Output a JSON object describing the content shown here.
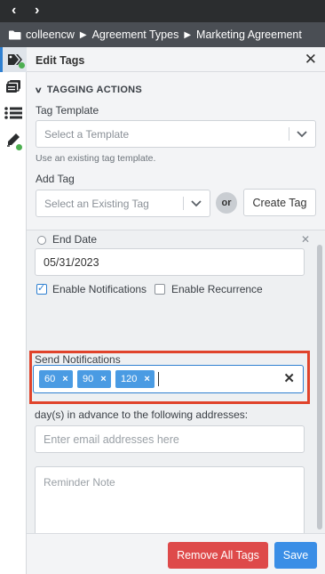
{
  "nav": {
    "back_icon": "chevron-left-icon",
    "forward_icon": "chevron-right-icon"
  },
  "breadcrumb": {
    "icon": "folder-icon",
    "items": [
      "colleencw",
      "Agreement Types",
      "Marketing Agreement"
    ]
  },
  "rail": {
    "items": [
      {
        "icon": "tag-icon",
        "active": true,
        "status_dot": true
      },
      {
        "icon": "stacked-documents-icon",
        "active": false,
        "status_dot": false
      },
      {
        "icon": "list-icon",
        "active": false,
        "status_dot": false
      },
      {
        "icon": "pen-icon",
        "active": false,
        "status_dot": true
      }
    ]
  },
  "panel": {
    "title": "Edit Tags",
    "section_title": "TAGGING ACTIONS",
    "tag_template": {
      "label": "Tag Template",
      "placeholder": "Select a Template",
      "hint": "Use an existing tag template."
    },
    "add_tag": {
      "label": "Add Tag",
      "placeholder": "Select an Existing Tag",
      "or_label": "or",
      "create_label": "Create Tag"
    },
    "end_date": {
      "label": "End Date",
      "value": "05/31/2023"
    },
    "enable_notifications": {
      "label": "Enable Notifications",
      "checked": true
    },
    "enable_recurrence": {
      "label": "Enable Recurrence",
      "checked": false
    },
    "send_notifications": {
      "label": "Send Notifications",
      "chips": [
        "60",
        "90",
        "120"
      ]
    },
    "advance_text": "day(s) in advance to the following addresses:",
    "email_placeholder": "Enter email addresses here",
    "note_placeholder": "Reminder Note"
  },
  "footer": {
    "remove_label": "Remove All Tags",
    "save_label": "Save"
  },
  "colors": {
    "accent": "#3a8ee6",
    "danger": "#de4a4a",
    "highlight": "#e0432b",
    "status": "#4caf50"
  }
}
